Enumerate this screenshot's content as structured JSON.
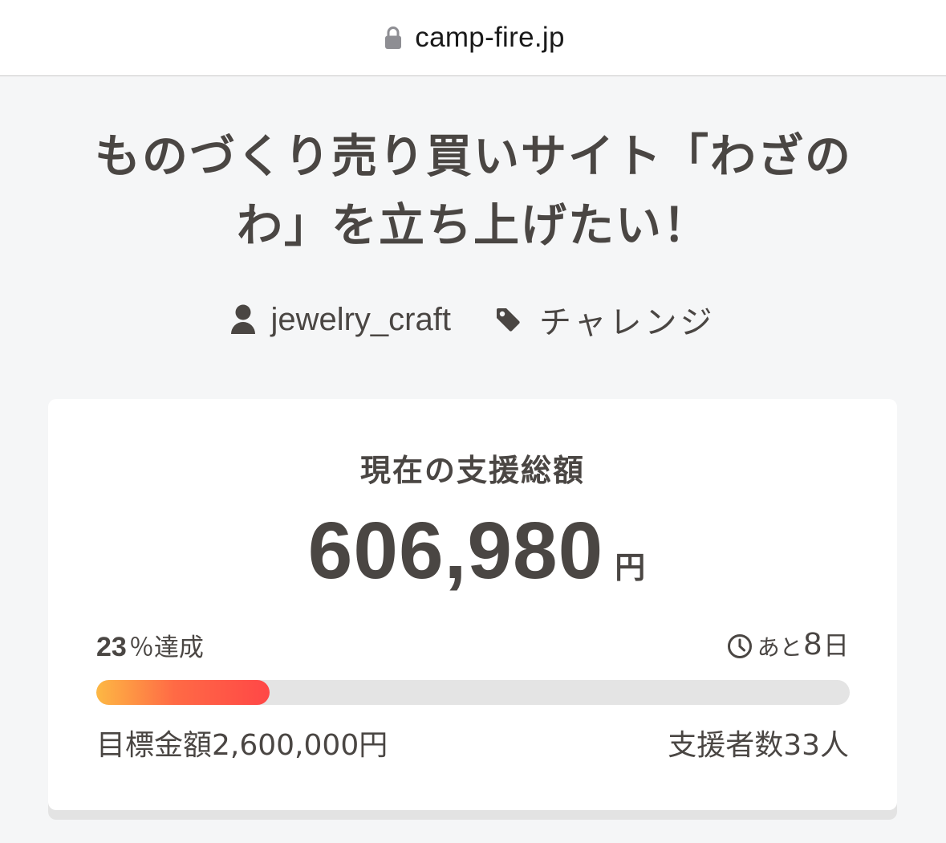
{
  "browser": {
    "url": "camp-fire.jp"
  },
  "project": {
    "title": "ものづくり売り買いサイト「わざのわ」を立ち上げたい！",
    "owner": "jewelry_craft",
    "category": "チャレンジ"
  },
  "funding": {
    "label": "現在の支援総額",
    "amount": "606,980",
    "currency": "円",
    "percent": "23",
    "percent_label": "％達成",
    "progress_fraction": 0.23,
    "remaining_prefix": "あと",
    "remaining_days": "8",
    "remaining_unit": "日",
    "goal": "目標金額2,600,000円",
    "supporters": "支援者数33人"
  },
  "colors": {
    "text": "#4a4643",
    "progress_start": "#fdb844",
    "progress_end": "#ff4747",
    "track": "#e4e4e4"
  },
  "icons": {
    "lock": "lock-icon",
    "owner": "user-icon",
    "category": "tag-icon",
    "remaining": "clock-icon"
  }
}
